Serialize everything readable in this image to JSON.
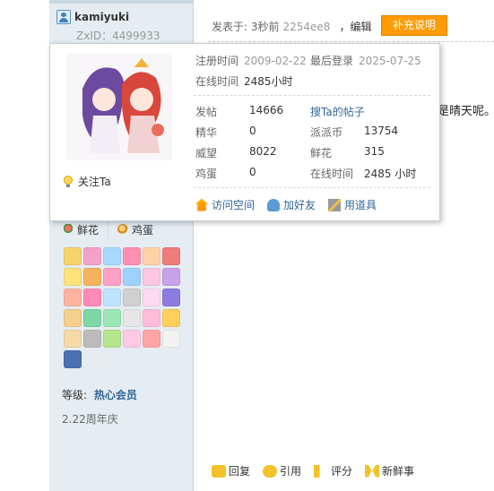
{
  "user": {
    "name": "kamiyuki",
    "zxid_label": "ZxID：4499933"
  },
  "post": {
    "meta_prefix": "发表于: 3秒前",
    "meta_id": "2254ee8",
    "edit_label": "，编辑",
    "supplement_button": "补充说明",
    "body_excerpt": "是晴天呢。"
  },
  "popup": {
    "reg_label": "注册时间",
    "reg_value": "2009-02-22",
    "last_login_label": "最后登录",
    "last_login_value": "2025-07-25",
    "online_label": "在线时间",
    "online_value": "2485小时",
    "follow_label": "关注Ta",
    "stats": {
      "posts_label": "发帖",
      "posts_value": "14666",
      "search_posts_label": "搜Ta的帖子",
      "digest_label": "精华",
      "digest_value": "0",
      "coin_label": "派派币",
      "coin_value": "13754",
      "prestige_label": "威望",
      "prestige_value": "8022",
      "flowers_label": "鲜花",
      "flowers_value": "315",
      "eggs_label": "鸡蛋",
      "eggs_value": "0",
      "online2_label": "在线时间",
      "online2_value": "2485 小时"
    },
    "actions": {
      "visit_space": "访问空间",
      "add_friend": "加好友",
      "use_item": "用道具"
    }
  },
  "sidebar": {
    "flower_label": "鲜花",
    "egg_label": "鸡蛋",
    "level_label": "等级:",
    "level_value": "热心会员",
    "anniversary": "2.22周年庆"
  },
  "bottom_actions": {
    "reply": "回复",
    "quote": "引用",
    "rate": "评分",
    "news": "新鲜事"
  },
  "colors": {
    "accent_orange": "#ff9a00",
    "link_blue": "#336699",
    "sidebar_bg": "#e5edf2"
  }
}
